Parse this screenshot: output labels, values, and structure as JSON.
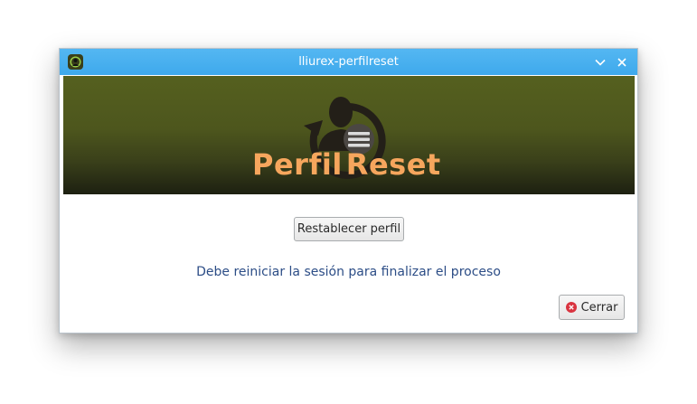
{
  "window": {
    "title": "lliurex-perfilreset"
  },
  "titlebar": {
    "icons": {
      "app": "app-logo-icon",
      "minimize": "chevron-down-icon",
      "close": "close-icon"
    }
  },
  "banner": {
    "logo_word1": "Perfil",
    "logo_word2": "Reset",
    "logo_color": "#f6a65d",
    "icon": "user-reset-icon",
    "menu_icon": "hamburger-menu-icon"
  },
  "main": {
    "reset_button_label": "Restablecer perfil",
    "status_message": "Debe reiniciar la sesión para finalizar el proceso"
  },
  "footer": {
    "close_button_label": "Cerrar",
    "close_icon": "close-circle-icon"
  },
  "colors": {
    "titlebar": "#3ea9ec",
    "message_text": "#2c4d86",
    "banner_top": "#55601f",
    "banner_bottom": "#1d2011",
    "close_icon_red": "#d9333f"
  }
}
